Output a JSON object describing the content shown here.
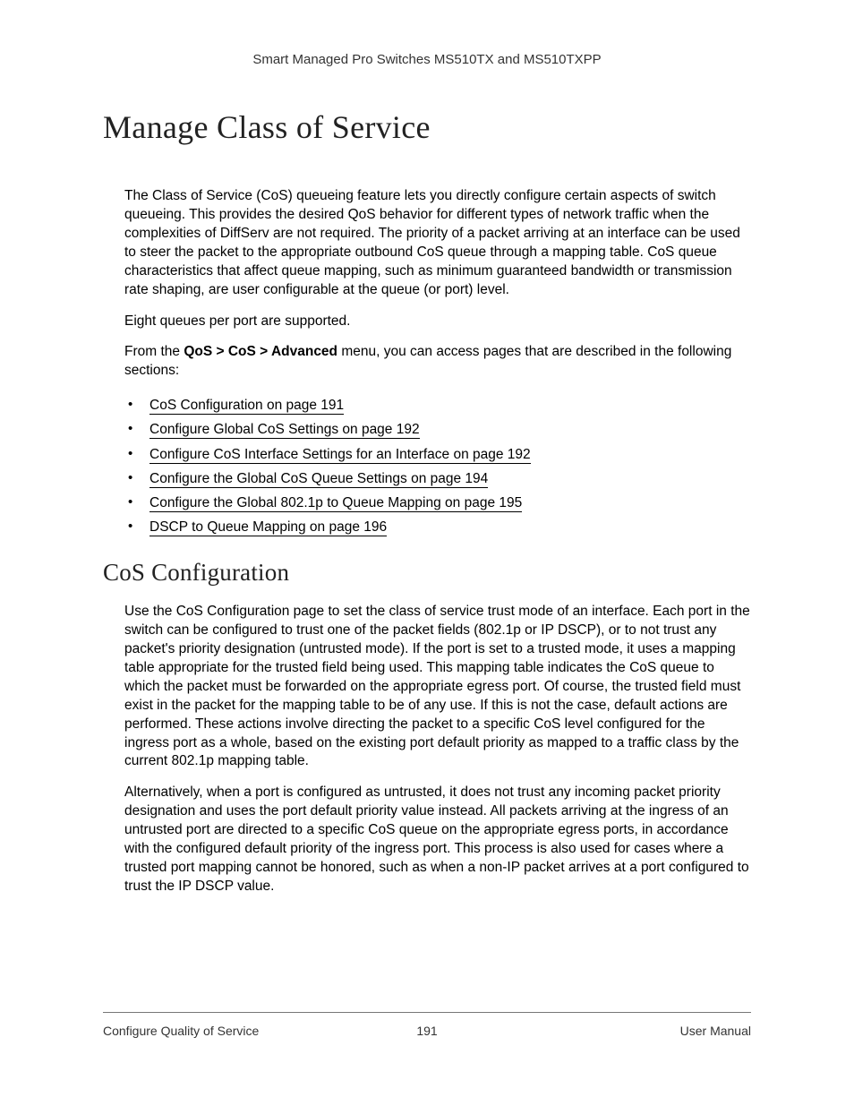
{
  "header": "Smart Managed Pro Switches MS510TX and MS510TXPP",
  "title": "Manage Class of Service",
  "intro_p1": "The Class of Service (CoS) queueing feature lets you directly configure certain aspects of switch queueing. This provides the desired QoS behavior for different types of network traffic when the complexities of DiffServ are not required. The priority of a packet arriving at an interface can be used to steer the packet to the appropriate outbound CoS queue through a mapping table. CoS queue characteristics that affect queue mapping, such as minimum guaranteed bandwidth or transmission rate shaping, are user configurable at the queue (or port) level.",
  "intro_p2": "Eight queues per port are supported.",
  "intro_p3_pre": "From the ",
  "intro_p3_bold": "QoS > CoS > Advanced",
  "intro_p3_post": " menu, you can access pages that are described in the following sections:",
  "links": [
    "CoS Configuration on page 191",
    "Configure Global CoS Settings on page 192",
    "Configure CoS Interface Settings for an Interface on page 192",
    "Configure the Global CoS Queue Settings on page 194",
    "Configure the Global 802.1p to Queue Mapping on page 195",
    "DSCP to Queue Mapping on page 196"
  ],
  "section_title": "CoS Configuration",
  "section_p1": "Use the CoS Configuration page to set the class of service trust mode of an interface. Each port in the switch can be configured to trust one of the packet fields (802.1p or IP DSCP), or to not trust any packet's priority designation (untrusted mode). If the port is set to a trusted mode, it uses a mapping table appropriate for the trusted field being used. This mapping table indicates the CoS queue to which the packet must be forwarded on the appropriate egress port. Of course, the trusted field must exist in the packet for the mapping table to be of any use. If this is not the case, default actions are performed. These actions involve directing the packet to a specific CoS level configured for the ingress port as a whole, based on the existing port default priority as mapped to a traffic class by the current 802.1p mapping table.",
  "section_p2": "Alternatively, when a port is configured as untrusted, it does not trust any incoming packet priority designation and uses the port default priority value instead. All packets arriving at the ingress of an untrusted port are directed to a specific CoS queue on the appropriate egress ports, in accordance with the configured default priority of the ingress port. This process is also used for cases where a trusted port mapping cannot be honored, such as when a non-IP packet arrives at a port configured to trust the IP DSCP value.",
  "footer": {
    "left": "Configure Quality of Service",
    "center": "191",
    "right": "User Manual"
  }
}
